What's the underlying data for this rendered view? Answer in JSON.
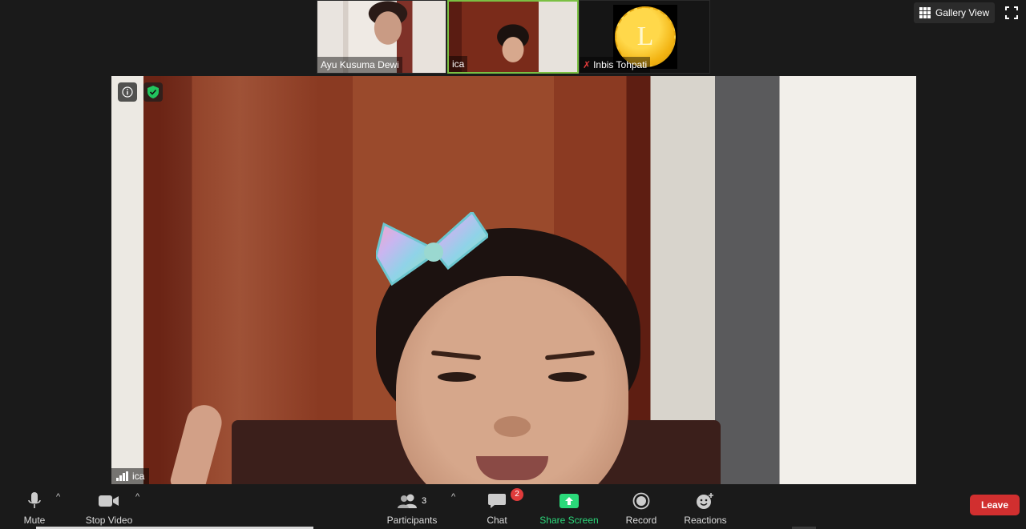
{
  "participants_strip": [
    {
      "name": "Ayu Kusuma Dewi",
      "muted": false,
      "active": false
    },
    {
      "name": "ica",
      "muted": false,
      "active": true
    },
    {
      "name": "Inbis Tohpati",
      "muted": true,
      "active": false,
      "avatar_letter": "L"
    }
  ],
  "top_controls": {
    "gallery_view_label": "Gallery View"
  },
  "main_video": {
    "speaker_name": "ica"
  },
  "toolbar": {
    "mute_label": "Mute",
    "stop_video_label": "Stop Video",
    "participants_label": "Participants",
    "participants_count": "3",
    "chat_label": "Chat",
    "chat_badge": "2",
    "share_screen_label": "Share Screen",
    "record_label": "Record",
    "reactions_label": "Reactions",
    "leave_label": "Leave"
  },
  "colors": {
    "share_green": "#2bd97a",
    "leave_red": "#d12f2f",
    "active_border": "#7bc043",
    "badge_red": "#e03b3b"
  }
}
